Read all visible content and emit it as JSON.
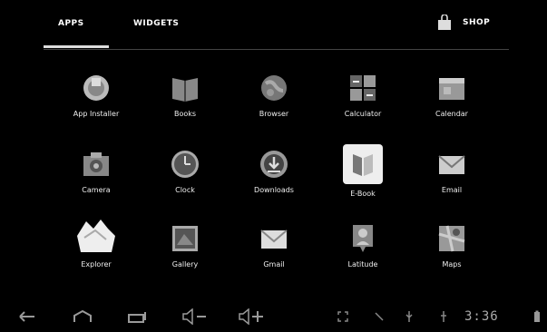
{
  "tabs": [
    {
      "label": "APPS"
    },
    {
      "label": "WIDGETS"
    }
  ],
  "shop": {
    "label": "SHOP",
    "icon": "shopping-bag-icon"
  },
  "apps": [
    {
      "label": "App Installer",
      "icon": "app-installer-icon"
    },
    {
      "label": "Books",
      "icon": "books-icon"
    },
    {
      "label": "Browser",
      "icon": "browser-globe-icon"
    },
    {
      "label": "Calculator",
      "icon": "calculator-icon"
    },
    {
      "label": "Calendar",
      "icon": "calendar-icon"
    },
    {
      "label": "Camera",
      "icon": "camera-icon"
    },
    {
      "label": "Clock",
      "icon": "clock-icon"
    },
    {
      "label": "Downloads",
      "icon": "downloads-icon"
    },
    {
      "label": "E-Book",
      "icon": "ebook-icon"
    },
    {
      "label": "Email",
      "icon": "email-icon"
    },
    {
      "label": "Explorer",
      "icon": "explorer-icon"
    },
    {
      "label": "Gallery",
      "icon": "gallery-icon"
    },
    {
      "label": "Gmail",
      "icon": "gmail-icon"
    },
    {
      "label": "Latitude",
      "icon": "latitude-icon"
    },
    {
      "label": "Maps",
      "icon": "maps-icon"
    }
  ],
  "status": {
    "time": "3:36"
  },
  "nav": {
    "back": "back-icon",
    "home": "home-icon",
    "recents": "recents-icon",
    "vol_down": "volume-down-icon",
    "vol_up": "volume-up-icon"
  }
}
